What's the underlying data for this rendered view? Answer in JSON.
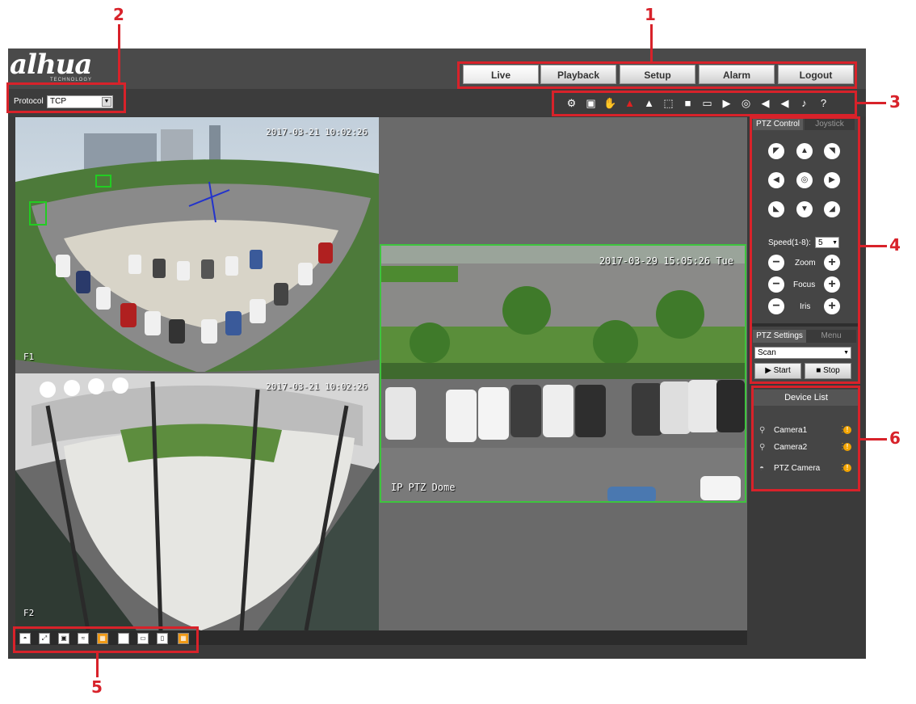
{
  "brand": {
    "logo": "alhua",
    "sub": "TECHNOLOGY"
  },
  "nav": {
    "tabs": [
      "Live",
      "Playback",
      "Setup",
      "Alarm",
      "Logout"
    ],
    "active": "Live"
  },
  "protocol": {
    "label": "Protocol",
    "value": "TCP"
  },
  "toolbar": {
    "icons": [
      "camera-settings-icon",
      "region-icon",
      "hand-icon",
      "alarm-red-icon",
      "alarm-icon",
      "zoom-region-icon",
      "fullscreen-icon",
      "screen-icon",
      "record-icon",
      "focus-icon",
      "audio-in-icon",
      "audio-out-icon",
      "microphone-icon",
      "help-icon"
    ]
  },
  "video": {
    "ch1_timestamp": "2017-03-21 10:02:26",
    "ch1_label": "F1",
    "ch2_timestamp": "2017-03-21 10:02:26",
    "ch2_label": "F2",
    "ptz_timestamp": "2017-03-29 15:05:26 Tue",
    "ptz_label": "IP PTZ Dome"
  },
  "ptz": {
    "tab_active": "PTZ Control",
    "tab_inactive": "Joystick",
    "speed_label": "Speed(1-8):",
    "speed_value": "5",
    "zoom_label": "Zoom",
    "focus_label": "Focus",
    "iris_label": "Iris",
    "settings_tab": "PTZ Settings",
    "menu_tab": "Menu",
    "mode": "Scan",
    "start": "Start",
    "stop": "Stop"
  },
  "device_list": {
    "title": "Device List",
    "items": [
      "Camera1",
      "Camera2",
      "PTZ Camera"
    ]
  },
  "annotations": {
    "n1": "1",
    "n2": "2",
    "n3": "3",
    "n4": "4",
    "n5": "5",
    "n6": "6"
  },
  "colors": {
    "annotation": "#d8222a",
    "accent": "#f09a17",
    "frame": "#3a3a3a"
  }
}
